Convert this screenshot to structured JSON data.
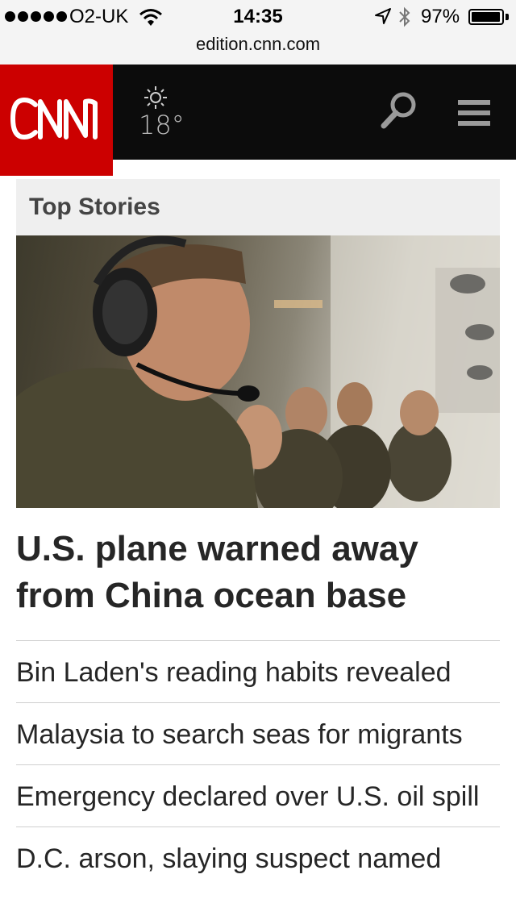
{
  "status_bar": {
    "carrier": "O2-UK",
    "time": "14:35",
    "battery_percent": "97%",
    "battery_level": 0.97,
    "url": "edition.cnn.com",
    "icons": [
      "signal-dots",
      "wifi-icon",
      "location-arrow-icon",
      "bluetooth-icon",
      "battery-icon"
    ]
  },
  "header": {
    "logo_text": "CNN",
    "weather_icon": "sun-icon",
    "temperature": "18°",
    "search_icon": "search-icon",
    "menu_icon": "hamburger-menu-icon",
    "colors": {
      "brand_red": "#cc0000",
      "header_bg": "#0c0c0c"
    }
  },
  "section": {
    "title": "Top Stories"
  },
  "hero": {
    "headline": "U.S. plane warned away from China ocean base"
  },
  "stories": [
    {
      "title": "Bin Laden's reading habits revealed"
    },
    {
      "title": "Malaysia to search seas for migrants"
    },
    {
      "title": "Emergency declared over U.S. oil spill"
    },
    {
      "title": "D.C. arson, slaying suspect named"
    }
  ]
}
